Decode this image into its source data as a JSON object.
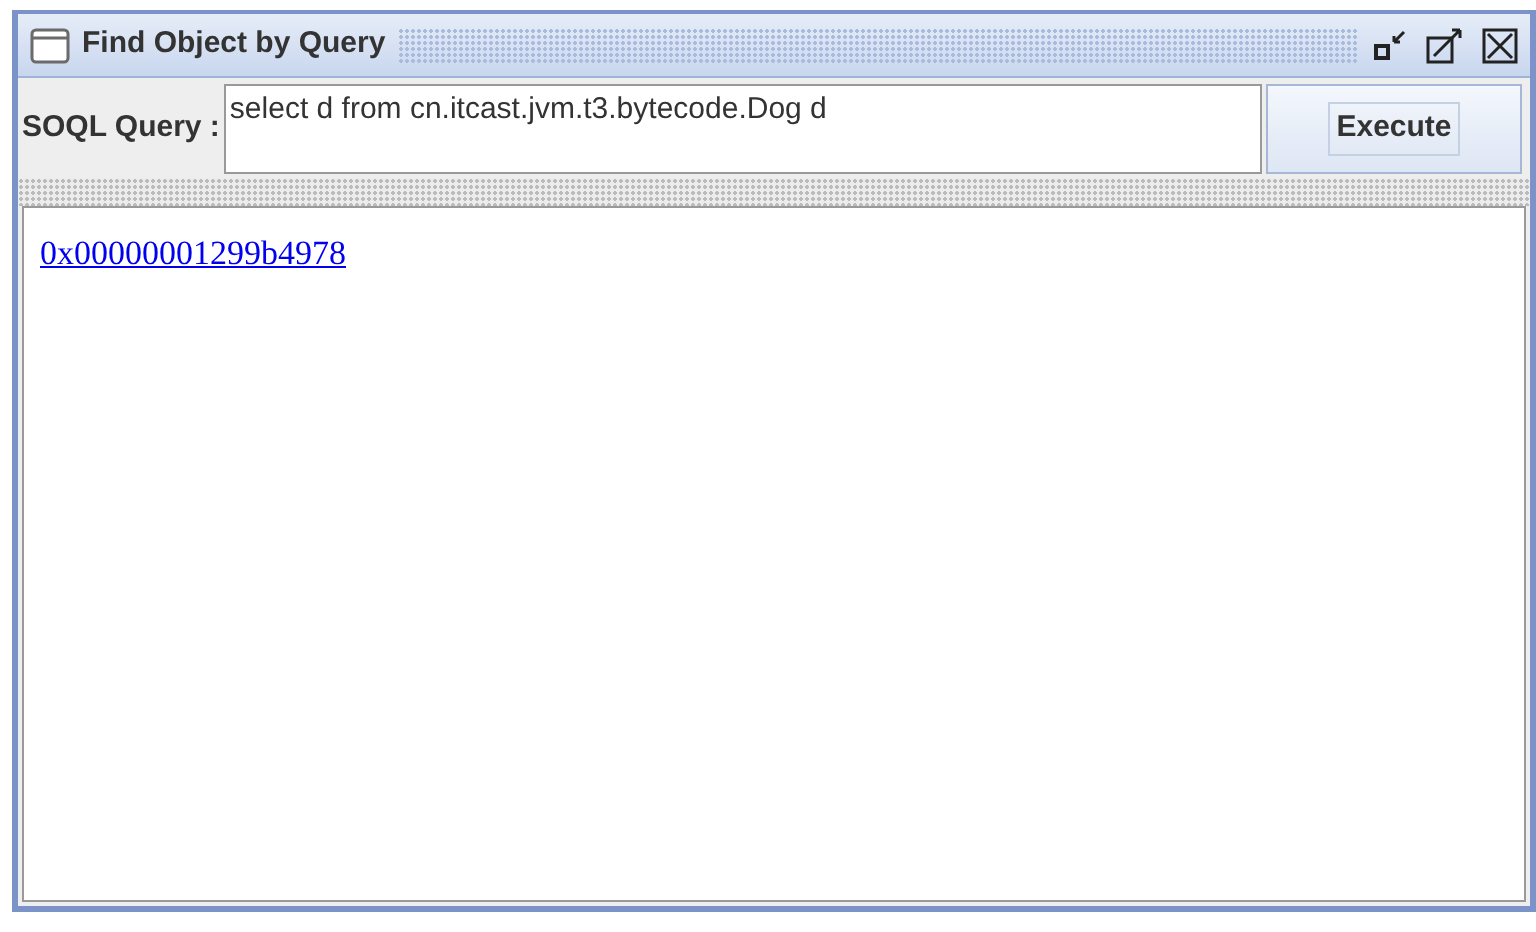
{
  "window": {
    "title": "Find Object by Query"
  },
  "query": {
    "label": "SOQL Query :",
    "value": "select d from cn.itcast.jvm.t3.bytecode.Dog d",
    "button": "Execute"
  },
  "results": [
    {
      "text": "0x00000001299b4978"
    }
  ]
}
